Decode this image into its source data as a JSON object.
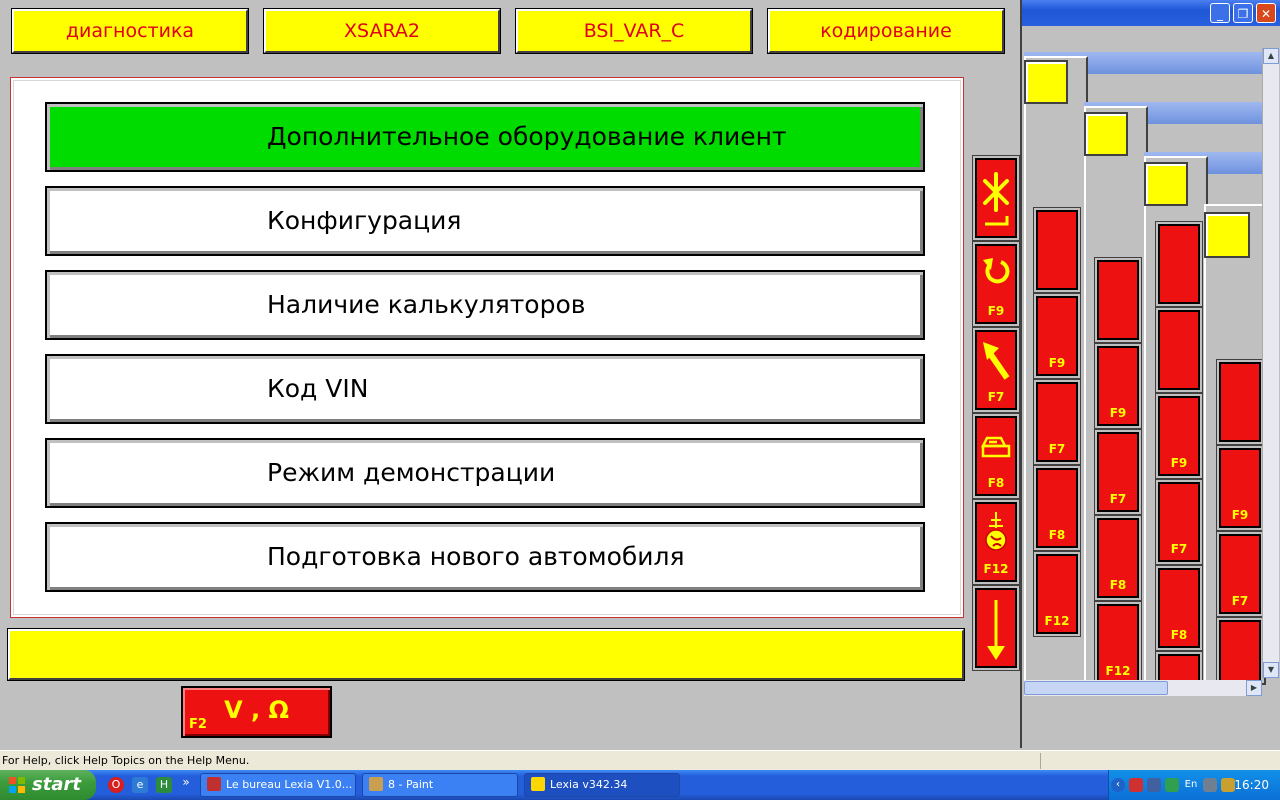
{
  "top_tabs": [
    {
      "label": "диагностика"
    },
    {
      "label": "XSARA2"
    },
    {
      "label": "BSI_VAR_C"
    },
    {
      "label": "кодирование"
    }
  ],
  "menu_items": [
    {
      "label": "Дополнительное оборудование клиент",
      "active": true
    },
    {
      "label": "Конфигурация"
    },
    {
      "label": "Наличие калькуляторов"
    },
    {
      "label": "Код VIN"
    },
    {
      "label": "Режим демонстрации"
    },
    {
      "label": "Подготовка нового автомобиля"
    }
  ],
  "function_keys": {
    "f9": "F9",
    "f7": "F7",
    "f8": "F8",
    "f12": "F12",
    "f2": "F2"
  },
  "measure_button": {
    "label": "V , Ω",
    "key": "F2"
  },
  "status_help": "For Help, click Help Topics on the Help Menu.",
  "taskbar": {
    "start_label": "start",
    "tasks": [
      {
        "label": "Le bureau Lexia V1.0..."
      },
      {
        "label": "8 - Paint"
      },
      {
        "label": "Lexia v342.34"
      }
    ],
    "language": "En",
    "clock": "16:20",
    "overflow": "»"
  },
  "colors": {
    "accent_red": "#ee1111",
    "highlight_green": "#00dc00",
    "bar_yellow": "#ffff00",
    "tab_text": "#e0001a"
  }
}
